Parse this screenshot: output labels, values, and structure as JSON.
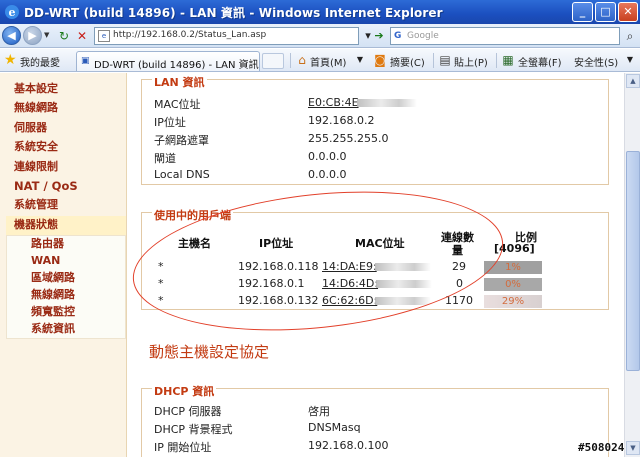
{
  "window": {
    "title": "DD-WRT (build 14896) - LAN 資訊 - Windows Internet Explorer",
    "buttons": {
      "minimize": "_",
      "maximize": "□",
      "close": "✕"
    }
  },
  "addressbar": {
    "url": "http://192.168.0.2/Status_Lan.asp",
    "search_placeholder": "Google"
  },
  "commandbar": {
    "favorites_label": "我的最愛",
    "tab_label": "DD-WRT (build 14896) - LAN 資訊",
    "items": [
      {
        "label": "首頁(M)",
        "icon": "home-icon"
      },
      {
        "label": "摘要(C)",
        "icon": "feed-icon"
      },
      {
        "label": "貼上(P)",
        "icon": "print-icon"
      },
      {
        "label": "全螢幕(F)",
        "icon": "fullscreen-icon"
      },
      {
        "label": "安全性(S)",
        "icon": "safety-icon"
      }
    ]
  },
  "sidebar": {
    "items": [
      "基本設定",
      "無線網路",
      "伺服器",
      "系統安全",
      "連線限制",
      "NAT / QoS",
      "系統管理",
      "機器狀態"
    ],
    "subitems": [
      "路由器",
      "WAN",
      "區域網路",
      "無線網路",
      "頻寬監控",
      "系統資訊"
    ]
  },
  "lan_info": {
    "legend": "LAN 資訊",
    "rows": [
      {
        "label": "MAC位址",
        "value": "E0:CB:4E"
      },
      {
        "label": "IP位址",
        "value": "192.168.0.2"
      },
      {
        "label": "子網路遮罩",
        "value": "255.255.255.0"
      },
      {
        "label": "閘道",
        "value": "0.0.0.0"
      },
      {
        "label": "Local DNS",
        "value": "0.0.0.0"
      }
    ]
  },
  "clients": {
    "legend": "使用中的用戶端",
    "headers": {
      "hostname": "主機名",
      "ip": "IP位址",
      "mac": "MAC位址",
      "conns_line1": "連線數",
      "conns_line2": "量",
      "ratio_line1": "比例",
      "ratio_line2": "[4096]"
    },
    "rows": [
      {
        "host": "*",
        "ip": "192.168.0.118",
        "mac": "14:DA:E9:",
        "conns": "29",
        "ratio_label": "1%",
        "ratio": 0.01
      },
      {
        "host": "*",
        "ip": "192.168.0.1",
        "mac": "14:D6:4D:",
        "conns": "0",
        "ratio_label": "0%",
        "ratio": 0.0
      },
      {
        "host": "*",
        "ip": "192.168.0.132",
        "mac": "6C:62:6D:",
        "conns": "1170",
        "ratio_label": "29%",
        "ratio": 0.29
      }
    ]
  },
  "dhcp_section_title": "動態主機設定協定",
  "dhcp_info": {
    "legend": "DHCP 資訊",
    "rows": [
      {
        "label": "DHCP 伺服器",
        "value": "啓用"
      },
      {
        "label": "DHCP 背景程式",
        "value": "DNSMasq"
      },
      {
        "label": "IP 開始位址",
        "value": "192.168.0.100"
      }
    ]
  },
  "watermark": "#508024",
  "colors": {
    "accent_red": "#c33b12",
    "sidebar_bg": "#fbf3e4",
    "annotation_circle": "#e2402a",
    "titlebar": "#1b4fbf"
  }
}
